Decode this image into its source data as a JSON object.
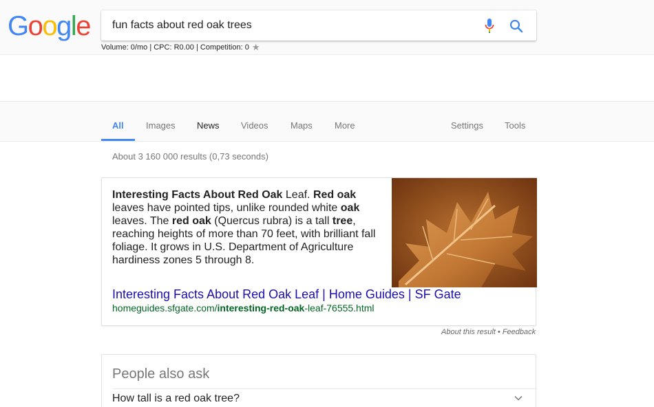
{
  "header": {
    "logo_letters": [
      {
        "ch": "G",
        "color": "#4285F4"
      },
      {
        "ch": "o",
        "color": "#EA4335"
      },
      {
        "ch": "o",
        "color": "#FBBC05"
      },
      {
        "ch": "g",
        "color": "#4285F4"
      },
      {
        "ch": "l",
        "color": "#34A853"
      },
      {
        "ch": "e",
        "color": "#EA4335"
      }
    ],
    "search_query": "fun facts about red oak trees",
    "seo_stats": "Volume: 0/mo | CPC: R0.00 | Competition: 0"
  },
  "tabs": {
    "all": "All",
    "images": "Images",
    "news": "News",
    "videos": "Videos",
    "maps": "Maps",
    "more": "More",
    "settings": "Settings",
    "tools": "Tools"
  },
  "results": {
    "stats": "About 3 160 000 results (0,73 seconds)"
  },
  "snippet": {
    "text": {
      "p1_bold": "Interesting Facts About Red Oak",
      "p1": " Leaf. ",
      "p2_bold": "Red oak",
      "p2": " leaves have pointed tips, unlike rounded white ",
      "p3_bold": "oak",
      "p3": " leaves. The ",
      "p4_bold": "red oak",
      "p4": " (Quercus rubra) is a tall ",
      "p5_bold": "tree",
      "p5": ", reaching heights of more than 70 feet, with brilliant fall foliage. It grows in U.S. Department of Agriculture hardiness zones 5 through 8."
    },
    "link_title": "Interesting Facts About Red Oak Leaf | Home Guides | SF Gate",
    "url_prefix": "homeguides.sfgate.com/",
    "url_bold": "interesting-red-oak",
    "url_suffix": "-leaf-76555.html"
  },
  "about_result": "About this result • Feedback",
  "people_also_ask": {
    "title": "People also ask",
    "questions": [
      "How tall is a red oak tree?"
    ]
  },
  "colors": {
    "accent_blue": "#4285f4",
    "link_blue": "#1a0dab",
    "url_green": "#006621"
  }
}
